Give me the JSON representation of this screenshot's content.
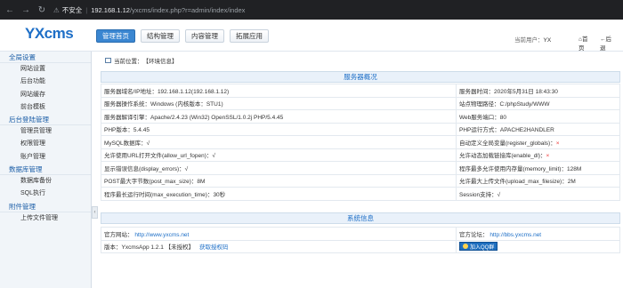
{
  "browser": {
    "warn": "不安全",
    "separator": "|",
    "host": "192.168.1.12",
    "path": "/yxcms/index.php?r=admin/index/index"
  },
  "header": {
    "logo": "YXcms",
    "tabs": [
      "管理首页",
      "结构管理",
      "内容管理",
      "拓展应用"
    ],
    "user_label": "当前用户：",
    "user_name": "YX",
    "home_link": "首页",
    "logout_link": "后退"
  },
  "sidebar": {
    "groups": [
      {
        "title": "全局设置",
        "items": [
          "网站设置",
          "后台功能",
          "网站缓存",
          "前台模板"
        ]
      },
      {
        "title": "后台登陆管理",
        "items": [
          "管理员管理",
          "权限管理",
          "账户管理"
        ]
      },
      {
        "title": "数据库管理",
        "items": [
          "数据库备份",
          "SQL执行"
        ]
      },
      {
        "title": "附件管理",
        "items": [
          "上传文件管理"
        ]
      }
    ],
    "collapse_glyph": "‹"
  },
  "main": {
    "location_label": "当前位置：",
    "location_value": "【环境信息】",
    "server_heading": "服务器概况",
    "server_rows": [
      [
        "服务器域名/IP地址：192.168.1.12(192.168.1.12)",
        "服务器时间：2020年5月31日 18:43:30"
      ],
      [
        "服务器操作系统：Windows (内核版本：STU1)",
        "站点物理路径：C:/phpStudy/WWW"
      ],
      [
        "服务器解译引擎：Apache/2.4.23 (Win32) OpenSSL/1.0.2j PHP/5.4.45",
        "Web服务端口：80"
      ],
      [
        "PHP版本：5.4.45",
        "PHP运行方式：APACHE2HANDLER"
      ],
      [
        "MySQL数据库：√",
        "自动定义全局变量(register_globals)：×"
      ],
      [
        "允许使用URL打开文件(allow_url_fopen)：√",
        "允许动态加载链接库(enable_dl)：×"
      ],
      [
        "显示错误信息(display_errors)：√",
        "程序最多允许使用内存量(memory_limit)：128M"
      ],
      [
        "POST最大字节数(post_max_size)：8M",
        "允许最大上传文件(upload_max_filesize)：2M"
      ],
      [
        "程序最长运行时间(max_execution_time)：30秒",
        "Session支持：√"
      ]
    ],
    "system_heading": "系统信息",
    "site_label": "官方网站：",
    "site_url": "http://www.yxcms.net",
    "forum_label": "官方论坛：",
    "forum_url": "http://bbs.yxcms.net",
    "version_text": "版本：YxcmsApp 1.2.1 【未授权】",
    "get_license": "获取授权码",
    "qq_button": "加入QQ群"
  }
}
